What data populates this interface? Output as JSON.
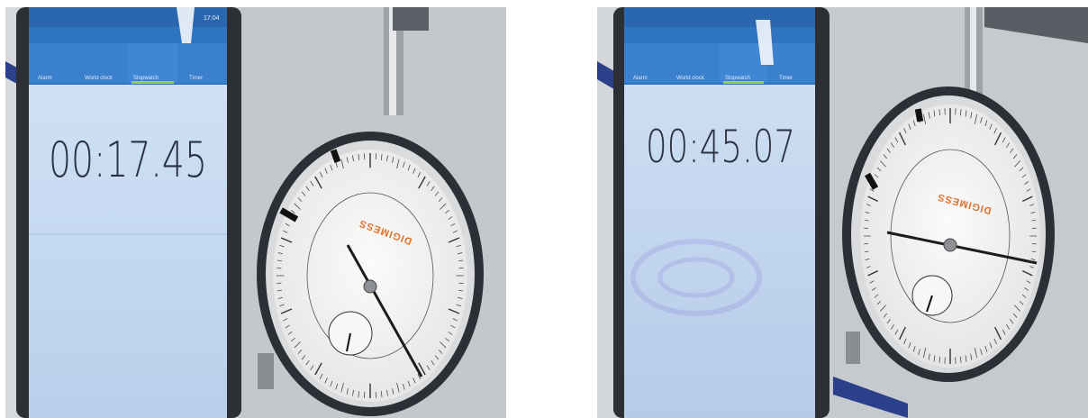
{
  "photos": [
    {
      "stopwatch_time": "00:17.45",
      "status_clock": "17:04",
      "tabs": [
        "Alarm",
        "World clock",
        "Stopwatch",
        "Timer"
      ],
      "gauge_brand": "DIGIMESS"
    },
    {
      "stopwatch_time": "00:45.07",
      "status_clock": "",
      "tabs": [
        "Alarm",
        "World clock",
        "Stopwatch",
        "Timer"
      ],
      "gauge_brand": "DIGIMESS"
    }
  ],
  "colors": {
    "screen": "#cfe0f4",
    "app_bar": "#2f74c0",
    "gauge_face": "#f4f4f2",
    "gauge_bezel": "#2b2f36",
    "brand": "#e0702c",
    "background_metal": "#bfc3c7"
  }
}
